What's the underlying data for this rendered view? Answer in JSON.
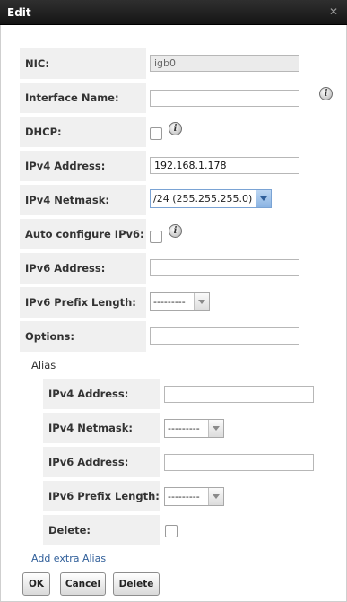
{
  "dialog": {
    "title": "Edit",
    "close_icon": "close-icon"
  },
  "form": {
    "nic": {
      "label": "NIC:",
      "value": "igb0"
    },
    "interface_name": {
      "label": "Interface Name:",
      "value": ""
    },
    "dhcp": {
      "label": "DHCP:",
      "checked": false
    },
    "ipv4_address": {
      "label": "IPv4 Address:",
      "value": "192.168.1.178"
    },
    "ipv4_netmask": {
      "label": "IPv4 Netmask:",
      "value": "/24 (255.255.255.0)"
    },
    "auto_ipv6": {
      "label": "Auto configure IPv6:",
      "checked": false
    },
    "ipv6_address": {
      "label": "IPv6 Address:",
      "value": ""
    },
    "ipv6_prefix": {
      "label": "IPv6 Prefix Length:",
      "value": "---------"
    },
    "options": {
      "label": "Options:",
      "value": ""
    }
  },
  "alias": {
    "heading": "Alias",
    "ipv4_address": {
      "label": "IPv4 Address:",
      "value": ""
    },
    "ipv4_netmask": {
      "label": "IPv4 Netmask:",
      "value": "---------"
    },
    "ipv6_address": {
      "label": "IPv6 Address:",
      "value": ""
    },
    "ipv6_prefix": {
      "label": "IPv6 Prefix Length:",
      "value": "---------"
    },
    "delete": {
      "label": "Delete:",
      "checked": false
    },
    "add_link": "Add extra Alias"
  },
  "buttons": {
    "ok": "OK",
    "cancel": "Cancel",
    "delete": "Delete"
  },
  "colors": {
    "titlebar": "#1f1f1f",
    "label_bg": "#f0f0f0",
    "link": "#2f5e99"
  }
}
